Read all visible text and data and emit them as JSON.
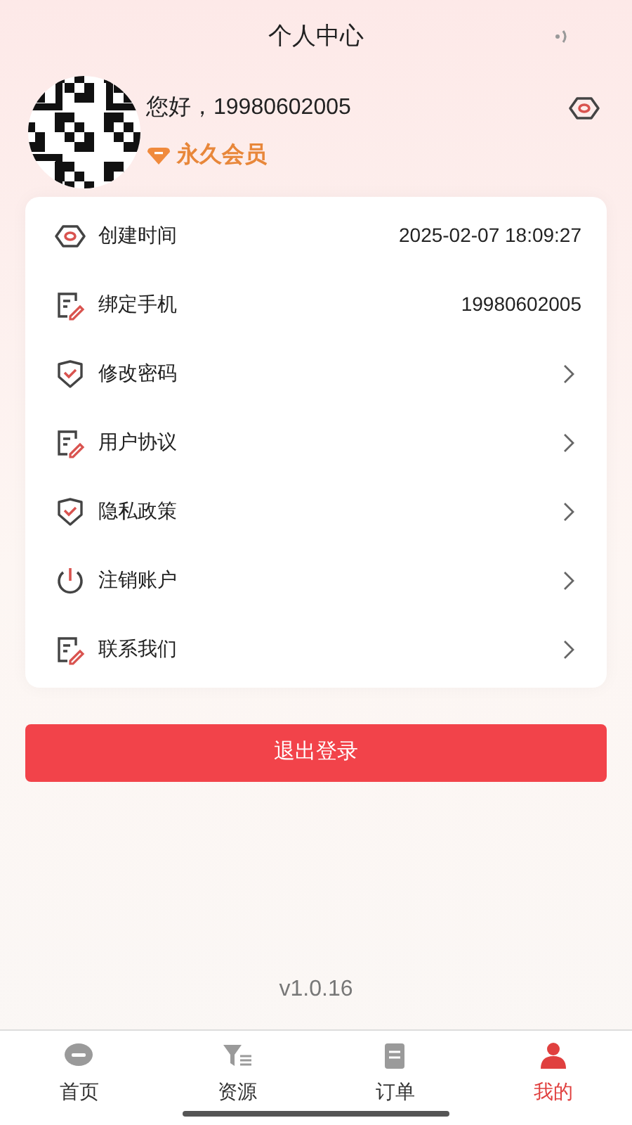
{
  "header": {
    "title": "个人中心"
  },
  "user": {
    "greeting": "您好，19980602005",
    "badge": "永久会员"
  },
  "rows": [
    {
      "kind": "value",
      "label": "创建时间",
      "value": "2025-02-07 18:09:27"
    },
    {
      "kind": "value",
      "label": "绑定手机",
      "value": "19980602005"
    },
    {
      "kind": "link",
      "label": "修改密码"
    },
    {
      "kind": "link",
      "label": "用户协议"
    },
    {
      "kind": "link",
      "label": "隐私政策"
    },
    {
      "kind": "link",
      "label": "注销账户"
    },
    {
      "kind": "link",
      "label": "联系我们"
    }
  ],
  "logout_button": "退出登录",
  "version": "v1.0.16",
  "tabs": [
    {
      "label": "首页",
      "selected": false
    },
    {
      "label": "资源",
      "selected": false
    },
    {
      "label": "订单",
      "selected": false
    },
    {
      "label": "我的",
      "selected": true
    }
  ]
}
